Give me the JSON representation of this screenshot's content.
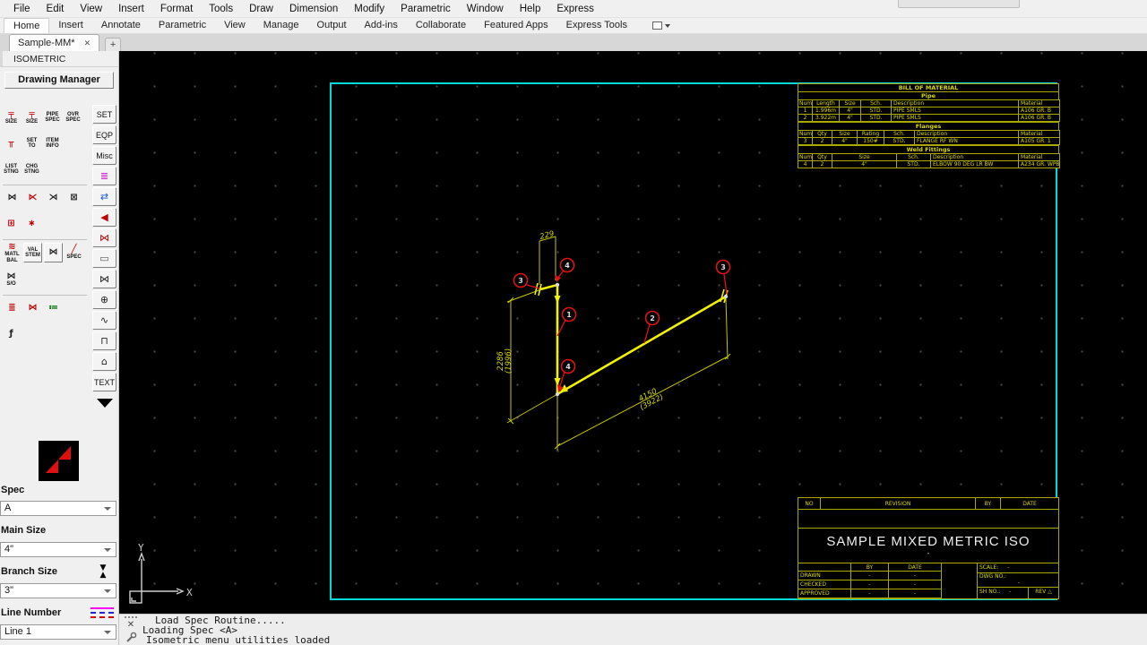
{
  "menu_bar": {
    "items": [
      "File",
      "Edit",
      "View",
      "Insert",
      "Format",
      "Tools",
      "Draw",
      "Dimension",
      "Modify",
      "Parametric",
      "Window",
      "Help",
      "Express"
    ]
  },
  "ribbon": {
    "tabs": [
      "Home",
      "Insert",
      "Annotate",
      "Parametric",
      "View",
      "Manage",
      "Output",
      "Add-ins",
      "Collaborate",
      "Featured Apps",
      "Express Tools"
    ],
    "active_index": 0
  },
  "doc_tabs": {
    "active_title": "Sample-MM*",
    "close_glyph": "✕",
    "new_tab_glyph": "+"
  },
  "palette": {
    "header": "ISOMETRIC",
    "manager_button": "Drawing Manager",
    "tool_rows": [
      {
        "items": [
          {
            "name": "tool-main-size",
            "glyph": "╤",
            "color": "#c00000",
            "label": "SIZE"
          },
          {
            "name": "tool-red-size",
            "glyph": "╤",
            "color": "#c00000",
            "label": "SIZE"
          },
          {
            "name": "tool-pipe-spec",
            "label": "PIPE\nSPEC"
          },
          {
            "name": "tool-ovr-spec",
            "label": "OVR\nSPEC"
          }
        ]
      },
      {
        "items": [
          {
            "name": "tool-tee-fit",
            "glyph": "╥",
            "color": "#c00000"
          },
          {
            "name": "tool-set-to",
            "label": "SET\nTO"
          },
          {
            "name": "tool-item-info",
            "label": "ITEM\nINFO"
          }
        ]
      },
      {
        "items": [
          {
            "name": "tool-list-stng",
            "label": "LIST\nSTNG"
          },
          {
            "name": "tool-chg-stng",
            "label": "CHG\nSTNG"
          }
        ]
      },
      {
        "divider": true,
        "items": [
          {
            "name": "tool-valve-insert",
            "glyph": "⋈",
            "color": "#222"
          },
          {
            "name": "tool-valve-cut",
            "glyph": "⋉",
            "color": "#c00000"
          },
          {
            "name": "tool-valve-flange",
            "glyph": "⋊",
            "color": "#222"
          },
          {
            "name": "tool-gasket",
            "glyph": "⊠",
            "color": "#222"
          }
        ]
      },
      {
        "items": [
          {
            "name": "tool-weld-gap",
            "glyph": "⊞",
            "color": "#c00000"
          },
          {
            "name": "tool-size-flag",
            "glyph": "∗",
            "color": "#c00000"
          }
        ]
      },
      {
        "divider": true,
        "items": [
          {
            "name": "tool-matl-bal",
            "glyph": "≋",
            "color": "#c00000",
            "label": "MATL\nBAL"
          },
          {
            "name": "tool-val-stem",
            "label": "VAL\nSTEM",
            "raised": true
          },
          {
            "name": "tool-check-valve",
            "glyph": "⋈",
            "color": "#222",
            "raised": true
          },
          {
            "name": "tool-spec-pen",
            "glyph": "╱",
            "color": "#c00000",
            "label": "SPEC"
          }
        ]
      },
      {
        "items": [
          {
            "name": "tool-stub-out",
            "glyph": "⋈",
            "color": "#222",
            "label": "S/O"
          }
        ]
      },
      {
        "divider": true,
        "items": [
          {
            "name": "tool-iso-lines",
            "glyph": "≣",
            "color": "#c00000"
          },
          {
            "name": "tool-bowtie-x",
            "glyph": "⋈",
            "color": "#c00000"
          },
          {
            "name": "tool-bom-list",
            "glyph": "≔",
            "color": "#007000"
          }
        ]
      },
      {
        "items": [
          {
            "name": "tool-slope-symbol",
            "glyph": "ƒ",
            "color": "#222"
          }
        ]
      }
    ],
    "side_buttons": [
      {
        "name": "side-set",
        "label": "SET"
      },
      {
        "name": "side-eqp",
        "label": "EQP"
      },
      {
        "name": "side-misc",
        "label": "Misc"
      },
      {
        "name": "side-line-styles",
        "glyph": "≣",
        "color": "#cc00cc"
      },
      {
        "name": "side-move-arrows",
        "glyph": "⇄",
        "color": "#1a56c4"
      },
      {
        "name": "side-valve-a",
        "glyph": "◀",
        "color": "#c00000"
      },
      {
        "name": "side-valve-b",
        "glyph": "⋈",
        "color": "#c00000"
      },
      {
        "name": "side-duct",
        "glyph": "▭",
        "color": "#555555"
      },
      {
        "name": "side-bowtie",
        "glyph": "⋈",
        "color": "#222222"
      },
      {
        "name": "side-pump-circle",
        "glyph": "⊕",
        "color": "#222222"
      },
      {
        "name": "side-swage",
        "glyph": "∿",
        "color": "#222222"
      },
      {
        "name": "side-support",
        "glyph": "⊓",
        "color": "#222222"
      },
      {
        "name": "side-pump",
        "glyph": "⌂",
        "color": "#222222"
      },
      {
        "name": "side-text",
        "label": "TEXT"
      },
      {
        "name": "palette-overflow-arrow",
        "arrow": true
      }
    ]
  },
  "spec_panel": {
    "spec_label": "Spec",
    "spec_value": "A",
    "main_size_label": "Main Size",
    "main_size_value": "4\"",
    "branch_size_label": "Branch Size",
    "branch_size_value": "3\"",
    "line_number_label": "Line Number",
    "line_value": "Line 1"
  },
  "canvas": {
    "bom": {
      "title": "BILL OF MATERIAL",
      "sections": [
        {
          "name": "Pipe",
          "headers": [
            "Num",
            "Length",
            "Size",
            "Sch.",
            "Description",
            "Material"
          ],
          "widths": [
            16,
            30,
            24,
            34,
            142,
            46
          ],
          "left_cols": [
            4,
            5
          ],
          "rows": [
            [
              "1",
              "1.996m",
              "4\"",
              "STD.",
              "PIPE SMLS",
              "A106 GR. B"
            ],
            [
              "2",
              "3.922m",
              "4\"",
              "STD.",
              "PIPE SMLS",
              "A106 GR. B"
            ]
          ]
        },
        {
          "name": "Flanges",
          "headers": [
            "Num",
            "Qty",
            "Size",
            "Rating",
            "Sch.",
            "Description",
            "Material"
          ],
          "widths": [
            16,
            22,
            28,
            30,
            34,
            116,
            46
          ],
          "left_cols": [
            5,
            6
          ],
          "rows": [
            [
              "3",
              "2",
              "4\"",
              "150#",
              "STD.",
              "FLANGE RF WN",
              "A105 GR. 1"
            ]
          ]
        },
        {
          "name": "Weld Fittings",
          "headers": [
            "Num",
            "Qty",
            "Size",
            "Sch.",
            "Description",
            "Material"
          ],
          "widths": [
            16,
            22,
            72,
            38,
            98,
            46
          ],
          "left_cols": [
            4,
            5
          ],
          "rows": [
            [
              "4",
              "2",
              "4\"",
              "STD.",
              "ELBOW 90 DEG LR BW",
              "A234 GR. WPB"
            ]
          ]
        }
      ]
    },
    "titleblock": {
      "no_label": "NO",
      "revision_label": "REVISION",
      "by_label": "BY",
      "date_label": "DATE",
      "title": "SAMPLE MIXED METRIC ISO",
      "subtitle": "-",
      "sign_rows": [
        {
          "label": "DRAWN",
          "by": "-",
          "date": "-"
        },
        {
          "label": "CHECKED",
          "by": "-",
          "date": "-"
        },
        {
          "label": "APPROVED",
          "by": "-",
          "date": "-"
        }
      ],
      "scale_label": "SCALE:",
      "scale_value": "-",
      "dwg_label": "DWG NO.:",
      "dwg_value": "-",
      "sh_label": "SH NO.:",
      "sh_value": "-",
      "rev_label": "REV",
      "rev_glyph": "△"
    },
    "drawing": {
      "dims": {
        "top": "229",
        "left_primary": "2286",
        "left_secondary": "(1996)",
        "diag_primary": "4150",
        "diag_secondary": "(3922)"
      },
      "balloons": [
        {
          "n": "3"
        },
        {
          "n": "4"
        },
        {
          "n": "1"
        },
        {
          "n": "2"
        },
        {
          "n": "4"
        },
        {
          "n": "3"
        }
      ],
      "ucs": {
        "x": "X",
        "y": "Y"
      }
    }
  },
  "command_line": {
    "close_glyph": "✕",
    "lines": [
      "Load Spec Routine.....",
      "Loading Spec <A>",
      "Isometric menu utilities loaded"
    ]
  }
}
